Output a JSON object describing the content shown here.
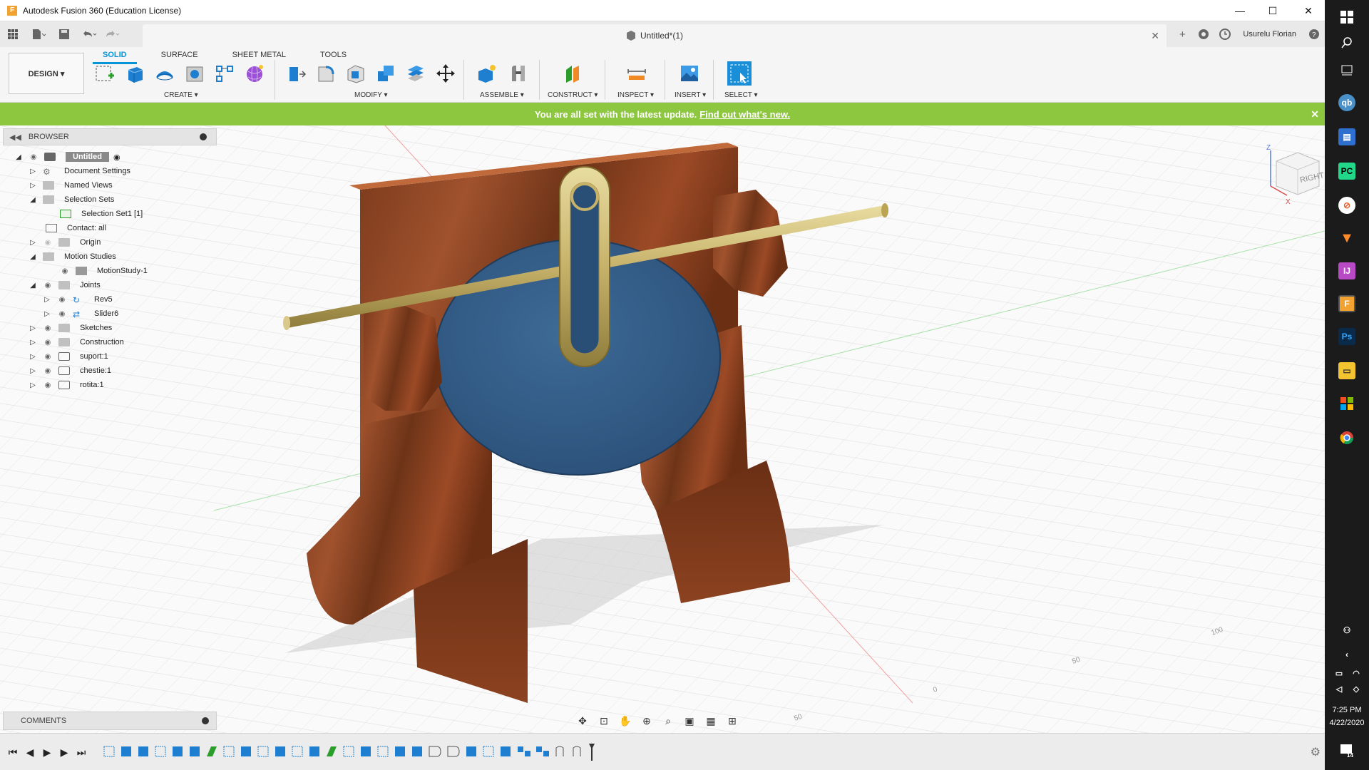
{
  "window": {
    "title": "Autodesk Fusion 360 (Education License)",
    "app_icon_letter": "F",
    "minimize": "—",
    "maximize": "☐",
    "close": "✕"
  },
  "document": {
    "tab_title": "Untitled*(1)",
    "tab_close": "✕"
  },
  "user": {
    "name": "Usurelu Florian"
  },
  "workspace": {
    "label": "DESIGN ▾"
  },
  "tabs": [
    "SOLID",
    "SURFACE",
    "SHEET METAL",
    "TOOLS"
  ],
  "groups": {
    "create": "CREATE ▾",
    "modify": "MODIFY ▾",
    "assemble": "ASSEMBLE ▾",
    "construct": "CONSTRUCT ▾",
    "inspect": "INSPECT ▾",
    "insert": "INSERT ▾",
    "select": "SELECT ▾"
  },
  "notice": {
    "text": "You are all set with the latest update.",
    "link": "Find out what's new.",
    "close": "✕"
  },
  "browser": {
    "title": "BROWSER",
    "root": "Untitled",
    "items": [
      {
        "label": "Document Settings"
      },
      {
        "label": "Named Views"
      },
      {
        "label": "Selection Sets"
      },
      {
        "label": "Selection Set1 [1]"
      },
      {
        "label": "Contact: all"
      },
      {
        "label": "Origin"
      },
      {
        "label": "Motion Studies"
      },
      {
        "label": "MotionStudy-1"
      },
      {
        "label": "Joints"
      },
      {
        "label": "Rev5"
      },
      {
        "label": "Slider6"
      },
      {
        "label": "Sketches"
      },
      {
        "label": "Construction"
      },
      {
        "label": "suport:1"
      },
      {
        "label": "chestie:1"
      },
      {
        "label": "rotita:1"
      }
    ]
  },
  "comments": {
    "title": "COMMENTS"
  },
  "viewcube": {
    "face": "RIGHT",
    "axis_z": "Z",
    "axis_x": "X"
  },
  "grid_labels": [
    "100",
    "50",
    "0",
    "50"
  ],
  "taskbar": {
    "time": "7:25 PM",
    "date": "4/22/2020",
    "notifications": "14"
  }
}
